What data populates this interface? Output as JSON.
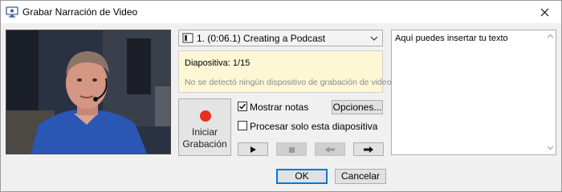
{
  "window": {
    "title": "Grabar Narración de Video"
  },
  "slide_selector": {
    "selected": "1. (0:06.1) Creating a Podcast"
  },
  "info": {
    "slide_line": "Diapositiva: 1/15",
    "device_message": "No se detectó ningún dispositivo de grabación de video"
  },
  "record": {
    "line1": "Iniciar",
    "line2": "Grabación",
    "dot_color": "#e8301f"
  },
  "options": {
    "show_notes_label": "Mostrar notas",
    "show_notes_checked": true,
    "only_this_slide_label": "Procesar solo esta diapositiva",
    "only_this_slide_checked": false,
    "options_button": "Opciones..."
  },
  "media_controls": [
    {
      "name": "play-icon",
      "enabled": true
    },
    {
      "name": "stop-icon",
      "enabled": false
    },
    {
      "name": "previous-icon",
      "enabled": false
    },
    {
      "name": "next-icon",
      "enabled": true
    }
  ],
  "notes": {
    "text": "Aquí puedes insertar tu texto"
  },
  "footer": {
    "ok": "OK",
    "cancel": "Cancelar"
  },
  "colors": {
    "accent": "#0078d7",
    "info_bg": "#fdf7d6"
  }
}
